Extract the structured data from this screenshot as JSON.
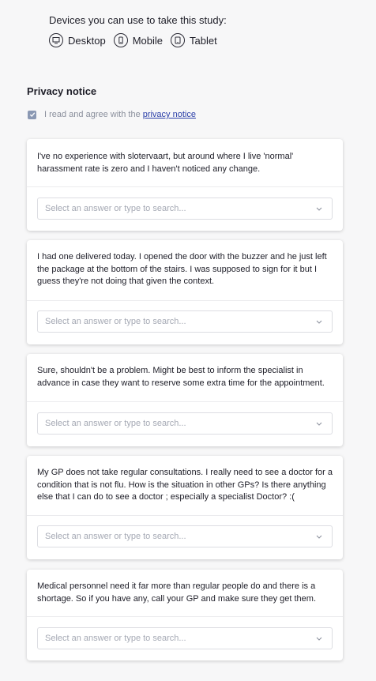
{
  "devices": {
    "title": "Devices you can use to take this study:",
    "items": [
      {
        "label": "Desktop",
        "icon": "desktop-icon"
      },
      {
        "label": "Mobile",
        "icon": "mobile-icon"
      },
      {
        "label": "Tablet",
        "icon": "tablet-icon"
      }
    ]
  },
  "privacy": {
    "heading": "Privacy notice",
    "agree_text": "I read and agree with the",
    "link_text": "privacy notice",
    "checked": true
  },
  "questions": [
    {
      "text": "I've no experience with slotervaart, but around where I live 'normal' harassment rate is zero and I haven't noticed any change.",
      "placeholder": "Select an answer or type to search..."
    },
    {
      "text": "I had one delivered today. I opened the door with the buzzer and he just left the package at the bottom of the stairs. I was supposed to sign for it but I guess they're not doing that given the context.",
      "placeholder": "Select an answer or type to search..."
    },
    {
      "text": "Sure, shouldn't be a problem. Might be best to inform the specialist in advance in case they want to reserve some extra time for the appointment.",
      "placeholder": "Select an answer or type to search..."
    },
    {
      "text": "My GP does not take regular consultations. I really need to see a doctor for a condition that is not flu. How is the situation in other GPs? Is there anything else that I can do to see a doctor ; especially a specialist Doctor? :(",
      "placeholder": "Select an answer or type to search..."
    },
    {
      "text": "Medical personnel need it far more than regular people do and there is a shortage. So if you have any, call your GP and make sure they get them.",
      "placeholder": "Select an answer or type to search..."
    }
  ],
  "colors": {
    "checkbox": "#8a98b3",
    "link": "#2b3fa8",
    "placeholder": "#a5a9b4"
  }
}
